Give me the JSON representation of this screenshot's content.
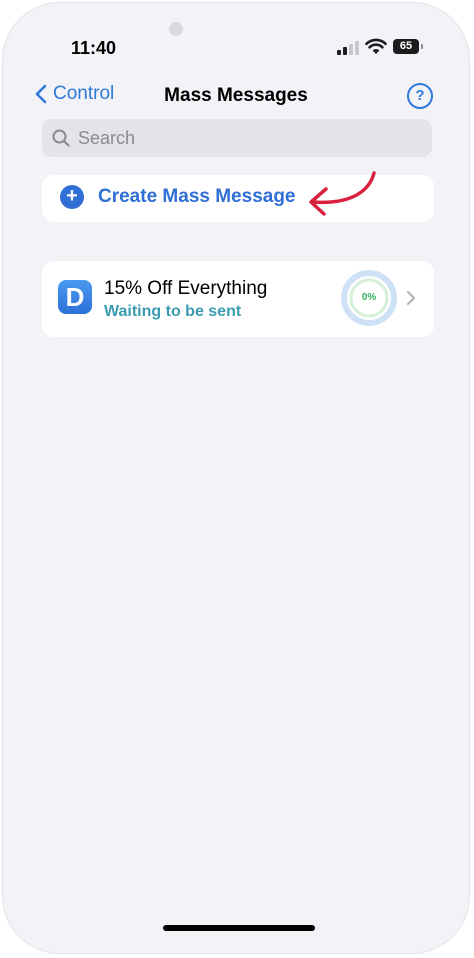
{
  "status_bar": {
    "time": "11:40",
    "battery": "65"
  },
  "navbar": {
    "back_label": "Control",
    "title": "Mass Messages",
    "help_glyph": "?"
  },
  "search": {
    "placeholder": "Search",
    "value": ""
  },
  "create": {
    "label": "Create Mass Message",
    "plus_glyph": "+"
  },
  "messages": [
    {
      "icon_letter": "D",
      "title": "15% Off Everything",
      "status": "Waiting to be sent",
      "progress_label": "0%",
      "progress_fraction": 0
    }
  ],
  "icons": {
    "back": "chevron-left-icon",
    "help": "question-circle-icon",
    "search": "magnifier-icon",
    "create": "plus-circle-icon",
    "annotation": "curved-arrow-icon",
    "row": "chevron-right-icon"
  },
  "colors": {
    "accent": "#2f6fd6",
    "status_teal": "#3a9bb0",
    "progress_green": "#34b45a",
    "annotation_red": "#d9213f",
    "background": "#f2f2f7"
  }
}
